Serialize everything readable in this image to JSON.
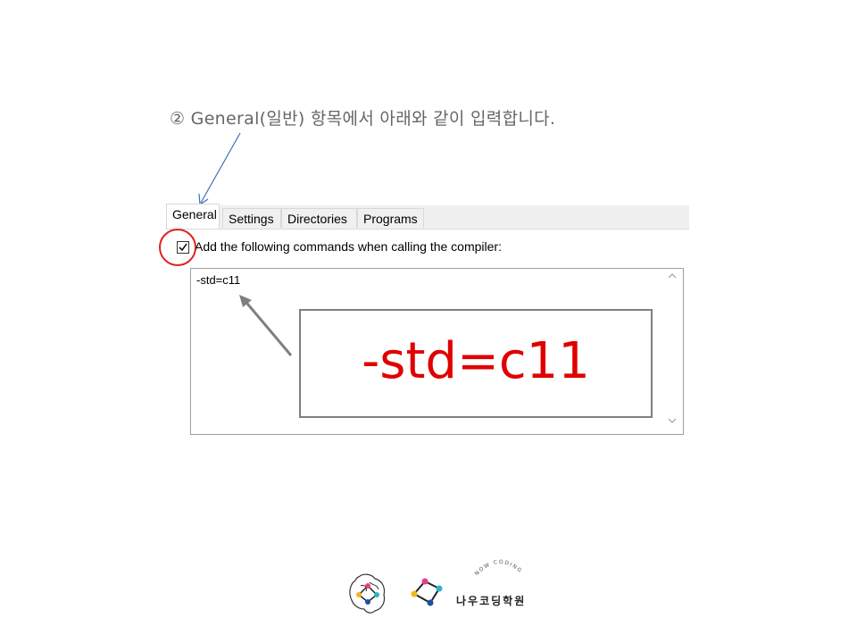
{
  "instruction": {
    "text": "② General(일반) 항목에서 아래와 같이 입력합니다."
  },
  "tabs": [
    {
      "label": "General",
      "active": true
    },
    {
      "label": "Settings",
      "active": false
    },
    {
      "label": "Directories",
      "active": false
    },
    {
      "label": "Programs",
      "active": false
    }
  ],
  "compiler_option": {
    "checked": true,
    "label": "Add the following commands when calling the compiler:"
  },
  "command_textarea": {
    "value": "-std=c11"
  },
  "callout": {
    "text": "-std=c11"
  },
  "branding": {
    "tagline": "NOW CODING",
    "name": "나우코딩학원"
  },
  "colors": {
    "highlight_circle": "#e02020",
    "callout_text": "#e00000",
    "arrow_blue": "#3a6fb5",
    "arrow_gray": "#7f7f7f"
  }
}
